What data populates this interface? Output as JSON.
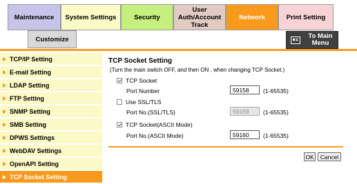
{
  "tabs": {
    "maintenance": "Maintenance",
    "system_settings": "System Settings",
    "security": "Security",
    "user_auth": "User Auth/Account Track",
    "network": "Network",
    "print_setting": "Print Setting"
  },
  "customize": "Customize",
  "to_main_menu": "To Main Menu",
  "sidebar": {
    "items": [
      {
        "label": "TCP/IP Setting"
      },
      {
        "label": "E-mail Setting"
      },
      {
        "label": "LDAP Setting"
      },
      {
        "label": "FTP Setting"
      },
      {
        "label": "SNMP Setting"
      },
      {
        "label": "SMB Setting"
      },
      {
        "label": "DPWS Settings"
      },
      {
        "label": "WebDAV Settings"
      },
      {
        "label": "OpenAPI Setting"
      },
      {
        "label": "TCP Socket Setting"
      }
    ]
  },
  "main": {
    "title": "TCP Socket Setting",
    "note": "(Turn the main switch OFF, and then ON , when changing TCP Socket.)",
    "tcp_socket": {
      "label": "TCP Socket",
      "checked": true
    },
    "port_number": {
      "label": "Port Number",
      "value": "59158",
      "range": "(1-65535)"
    },
    "use_ssl": {
      "label": "Use SSL/TLS",
      "checked": false
    },
    "port_ssl": {
      "label": "Port No.(SSL/TLS)",
      "value": "59159",
      "range": "(1-65535)"
    },
    "tcp_ascii": {
      "label": "TCP Socket(ASCII Mode)",
      "checked": true
    },
    "port_ascii": {
      "label": "Port No.(ASCII Mode)",
      "value": "59160",
      "range": "(1-65535)"
    },
    "ok": "OK",
    "cancel": "Cancel"
  }
}
